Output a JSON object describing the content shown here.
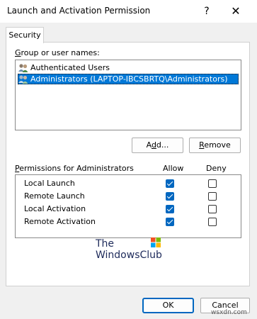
{
  "window": {
    "title": "Launch and Activation Permission",
    "help_glyph": "?",
    "close_glyph": "✕"
  },
  "tabs": [
    {
      "label": "Security"
    }
  ],
  "group": {
    "label_prefix": "G",
    "label_rest": "roup or user names:",
    "users": [
      {
        "name": "Authenticated Users",
        "selected": false
      },
      {
        "name": "Administrators (LAPTOP-IBCSBRTQ\\Administrators)",
        "selected": true
      }
    ],
    "add_button_prefix": "A",
    "add_button_underlined": "d",
    "add_button_suffix": "d...",
    "remove_button_underlined": "R",
    "remove_button_rest": "emove"
  },
  "permissions": {
    "header_underlined": "P",
    "header_rest": "ermissions for Administrators",
    "allow_label": "Allow",
    "deny_label": "Deny",
    "rows": [
      {
        "label": "Local Launch",
        "allow": true,
        "deny": false
      },
      {
        "label": "Remote Launch",
        "allow": true,
        "deny": false
      },
      {
        "label": "Local Activation",
        "allow": true,
        "deny": false
      },
      {
        "label": "Remote Activation",
        "allow": true,
        "deny": false
      }
    ]
  },
  "watermark": {
    "line1": "The",
    "line2": "WindowsClub"
  },
  "footer": {
    "ok_label": "OK",
    "cancel_label": "Cancel",
    "site_watermark": "wsxdn.com"
  },
  "colors": {
    "accent": "#0078d7",
    "checkbox": "#0067c0"
  }
}
